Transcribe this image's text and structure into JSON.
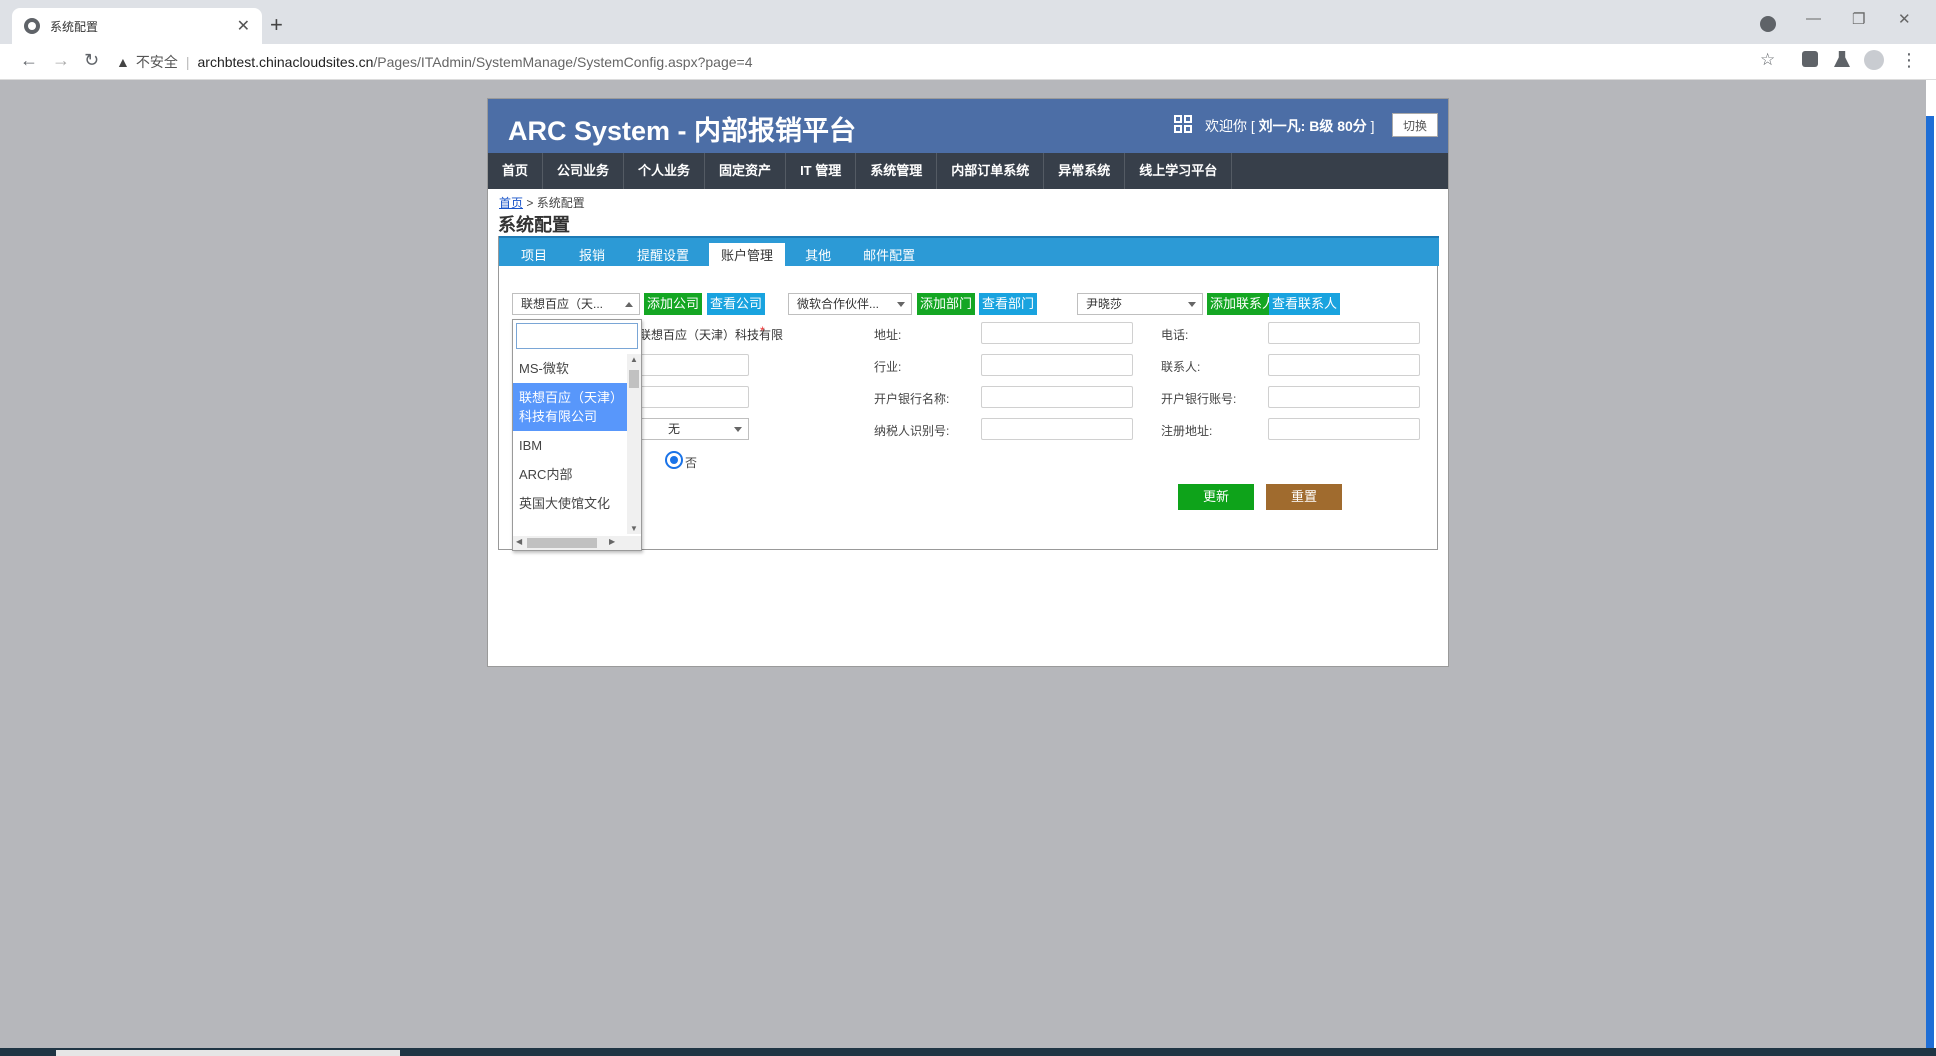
{
  "browser": {
    "tab_title": "系统配置",
    "tab_close": "✕",
    "new_tab": "+",
    "security_label": "不安全",
    "url_host": "archbtest.chinacloudsites.cn",
    "url_path": "/Pages/ITAdmin/SystemManage/SystemConfig.aspx?page=4"
  },
  "header": {
    "app_title": "ARC System - 内部报销平台",
    "welcome_prefix": "欢迎你 [ ",
    "welcome_user": "刘一凡:  B级 80分",
    "welcome_suffix": " ]",
    "switch_label": "切换"
  },
  "nav": {
    "items": [
      "首页",
      "公司业务",
      "个人业务",
      "固定资产",
      "IT 管理",
      "系统管理",
      "内部订单系统",
      "异常系统",
      "线上学习平台"
    ]
  },
  "breadcrumb": {
    "home": "首页",
    "sep": " > ",
    "current": "系统配置"
  },
  "page_title": "系统配置",
  "tabs": {
    "items": [
      "项目",
      "报销",
      "提醒设置",
      "账户管理",
      "其他",
      "邮件配置"
    ],
    "active": "账户管理"
  },
  "controls": {
    "company_select": "联想百应（天...",
    "add_company": "添加公司",
    "view_company": "查看公司",
    "dept_select": "微软合作伙伴...",
    "add_dept": "添加部门",
    "view_dept": "查看部门",
    "contact_select": "尹晓莎",
    "add_contact": "添加联系人",
    "view_contact": "查看联系人"
  },
  "form": {
    "company_name_value": "联想百应（天津）科技有限",
    "required_mark": "*",
    "address_label": "地址:",
    "phone_label": "电话:",
    "industry_label": "行业:",
    "contact_label": "联系人:",
    "bank_name_label": "开户银行名称:",
    "bank_account_label": "开户银行账号:",
    "tax_id_label": "纳税人识别号:",
    "reg_address_label": "注册地址:",
    "parent_select": "无",
    "radio_no_label": "否",
    "update_label": "更新",
    "reset_label": "重置"
  },
  "dropdown": {
    "options": [
      "MS-微软",
      "联想百应（天津）科技有限公司",
      "IBM",
      "ARC内部",
      "英国大使馆文化"
    ],
    "selected": "联想百应（天津）科技有限公司"
  },
  "colors": {
    "header_bg": "#4c6ea6",
    "nav_bg": "#373f4a",
    "tab_bar": "#2c9ad6",
    "btn_green": "#14a623",
    "btn_blue": "#19a3df",
    "update_green": "#0ea31a",
    "reset_brown": "#a06b2e"
  }
}
